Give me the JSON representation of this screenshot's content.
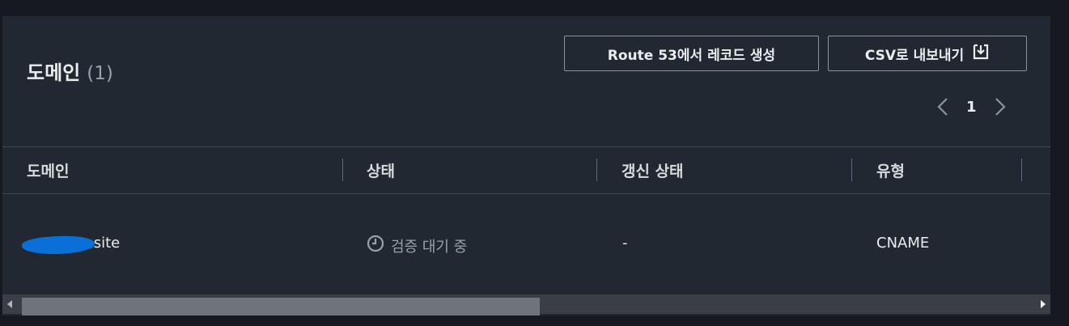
{
  "header": {
    "title": "도메인",
    "count": "(1)"
  },
  "actions": {
    "route53_label": "Route 53에서 레코드 생성",
    "csv_label": "CSV로 내보내기"
  },
  "pagination": {
    "current_page": "1"
  },
  "table": {
    "columns": [
      "도메인",
      "상태",
      "갱신 상태",
      "유형"
    ],
    "rows": [
      {
        "domain": ".site",
        "status": "검증 대기 중",
        "renewal": "-",
        "type": "CNAME"
      }
    ]
  },
  "colors": {
    "background": "#16191f",
    "panel": "#222831",
    "border": "#879596",
    "text": "#eaeded",
    "muted": "#95a5a6",
    "redaction": "#0a6fd6"
  },
  "icons": [
    "download-icon",
    "chevron-left-icon",
    "chevron-right-icon",
    "clock-icon"
  ]
}
